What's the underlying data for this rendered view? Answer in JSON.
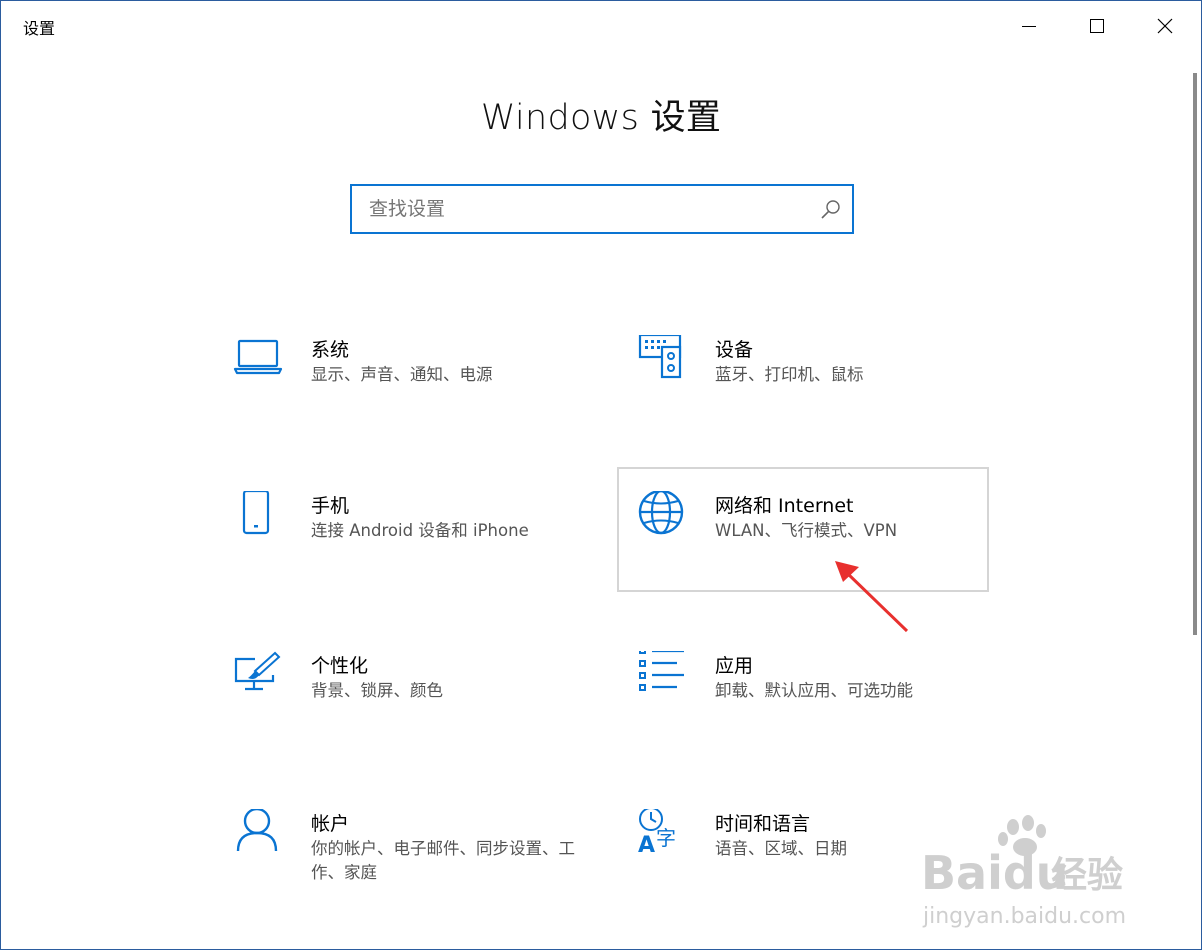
{
  "window": {
    "title": "设置"
  },
  "page": {
    "heading": "Windows 设置"
  },
  "search": {
    "placeholder": "查找设置",
    "icon": "search-icon"
  },
  "tiles": [
    {
      "title": "系统",
      "desc": "显示、声音、通知、电源",
      "icon": "laptop-icon"
    },
    {
      "title": "设备",
      "desc": "蓝牙、打印机、鼠标",
      "icon": "devices-icon"
    },
    {
      "title": "手机",
      "desc": "连接 Android 设备和 iPhone",
      "icon": "phone-icon"
    },
    {
      "title": "网络和 Internet",
      "desc": "WLAN、飞行模式、VPN",
      "icon": "globe-icon"
    },
    {
      "title": "个性化",
      "desc": "背景、锁屏、颜色",
      "icon": "personalization-icon"
    },
    {
      "title": "应用",
      "desc": "卸载、默认应用、可选功能",
      "icon": "apps-icon"
    },
    {
      "title": "帐户",
      "desc": "你的帐户、电子邮件、同步设置、工作、家庭",
      "icon": "account-icon"
    },
    {
      "title": "时间和语言",
      "desc": "语音、区域、日期",
      "icon": "time-language-icon"
    }
  ],
  "watermark": {
    "brand": "Baidu",
    "cn": "经验",
    "url": "jingyan.baidu.com"
  },
  "colors": {
    "accent": "#0a74d2",
    "annotation_arrow": "#e8302e"
  }
}
